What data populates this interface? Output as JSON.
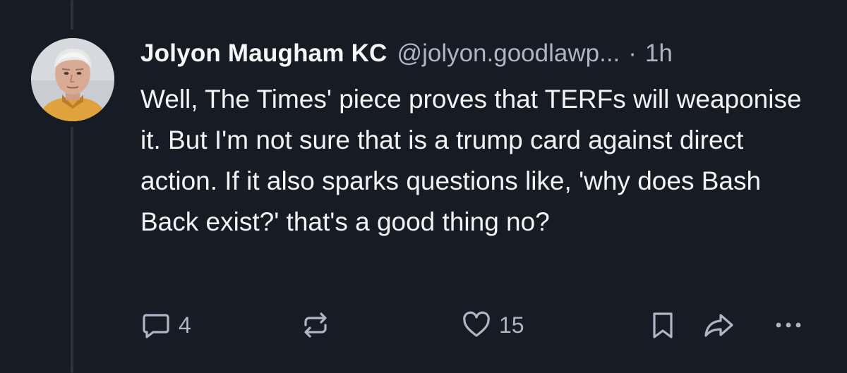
{
  "post": {
    "display_name": "Jolyon Maugham KC",
    "handle": "@jolyon.goodlawp...",
    "separator": "·",
    "time": "1h",
    "text": "Well, The Times' piece proves that TERFs will weaponise it. But I'm not sure that is a trump card against direct action. If it also sparks questions like, 'why does Bash Back exist?' that's a good thing no?"
  },
  "actions": {
    "reply_count": "4",
    "like_count": "15"
  },
  "icons": {
    "reply": "reply-icon",
    "repost": "repost-icon",
    "like": "heart-icon",
    "bookmark": "bookmark-icon",
    "share": "share-icon",
    "more": "more-icon"
  },
  "colors": {
    "background": "#171b24",
    "text": "#f1f3f5",
    "muted": "#aeb6c3",
    "thread_line": "#2c3340"
  }
}
